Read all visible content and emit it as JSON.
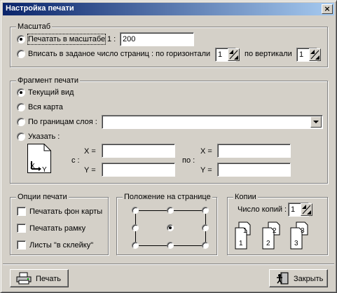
{
  "window": {
    "title": "Настройка печати",
    "close_glyph": "×"
  },
  "scale": {
    "legend": "Масштаб",
    "opt_scale_label": "Печатать в масштабе",
    "opt_scale_ratio": "1 :",
    "scale_value": "200",
    "opt_fit_label": "Вписать в заданое число страниц : по горизонтали",
    "pages_h": "1",
    "vertical_label": "по вертикали",
    "pages_v": "1"
  },
  "fragment": {
    "legend": "Фрагмент печати",
    "opt_current": "Текущий вид",
    "opt_whole": "Вся карта",
    "opt_layer": "По границам слоя :",
    "layer_value": "",
    "opt_specify": "Указать :",
    "from_label": "с :",
    "to_label": "по :",
    "x_label": "X =",
    "y_label": "Y =",
    "x_from": "",
    "y_from": "",
    "x_to": "",
    "y_to": "",
    "axis_x": "X",
    "axis_y": "Y"
  },
  "options": {
    "legend": "Опции печати",
    "print_bg": "Печатать фон карты",
    "print_frame": "Печатать рамку",
    "glue_sheets": "Листы \"в склейку\""
  },
  "position": {
    "legend": "Положение на странице",
    "selected": "center"
  },
  "copies": {
    "legend": "Копии",
    "count_label": "Число копий :",
    "count_value": "1",
    "page_numbers": [
      "1",
      "2",
      "3"
    ]
  },
  "footer": {
    "print_label": "Печать",
    "close_label": "Закрыть"
  }
}
